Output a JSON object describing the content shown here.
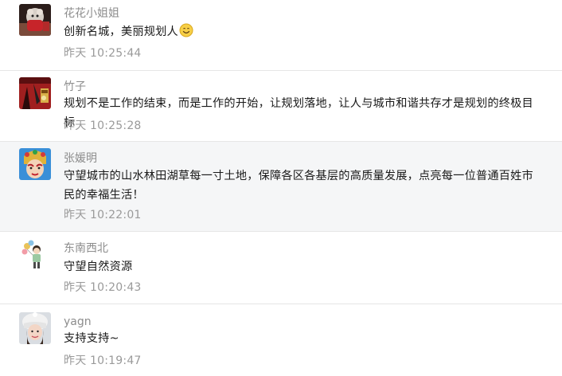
{
  "comments": [
    {
      "name": "花花小姐姐",
      "text": "创新名城，美丽规划人",
      "emoji": "smile-emoji",
      "time": "昨天 10:25:44",
      "avatar": "red-toy-avatar"
    },
    {
      "name": "竹子",
      "text": "规划不是工作的结束，而是工作的开始，让规划落地，让人与城市和谐共存才是规划的终极目标",
      "time": "昨天 10:25:28",
      "avatar": "red-room-avatar"
    },
    {
      "name": "张媛明",
      "text": "守望城市的山水林田湖草每一寸土地，保障各区各基层的高质量发展，点亮每一位普通百姓市民的幸福生活！",
      "time": "昨天 10:22:01",
      "avatar": "opera-mask-avatar"
    },
    {
      "name": "东南西北",
      "text": "守望自然资源",
      "time": "昨天 10:20:43",
      "avatar": "balloon-kid-avatar"
    },
    {
      "name": "yagn",
      "text": "支持支持~",
      "time": "昨天 10:19:47",
      "avatar": "girl-hat-avatar"
    }
  ],
  "colors": {
    "name": "#8d8d8d",
    "text": "#1a1a1a",
    "time": "#9a9a9a",
    "highlight_bg": "#f5f6f7",
    "divider": "#e6e6e6"
  }
}
